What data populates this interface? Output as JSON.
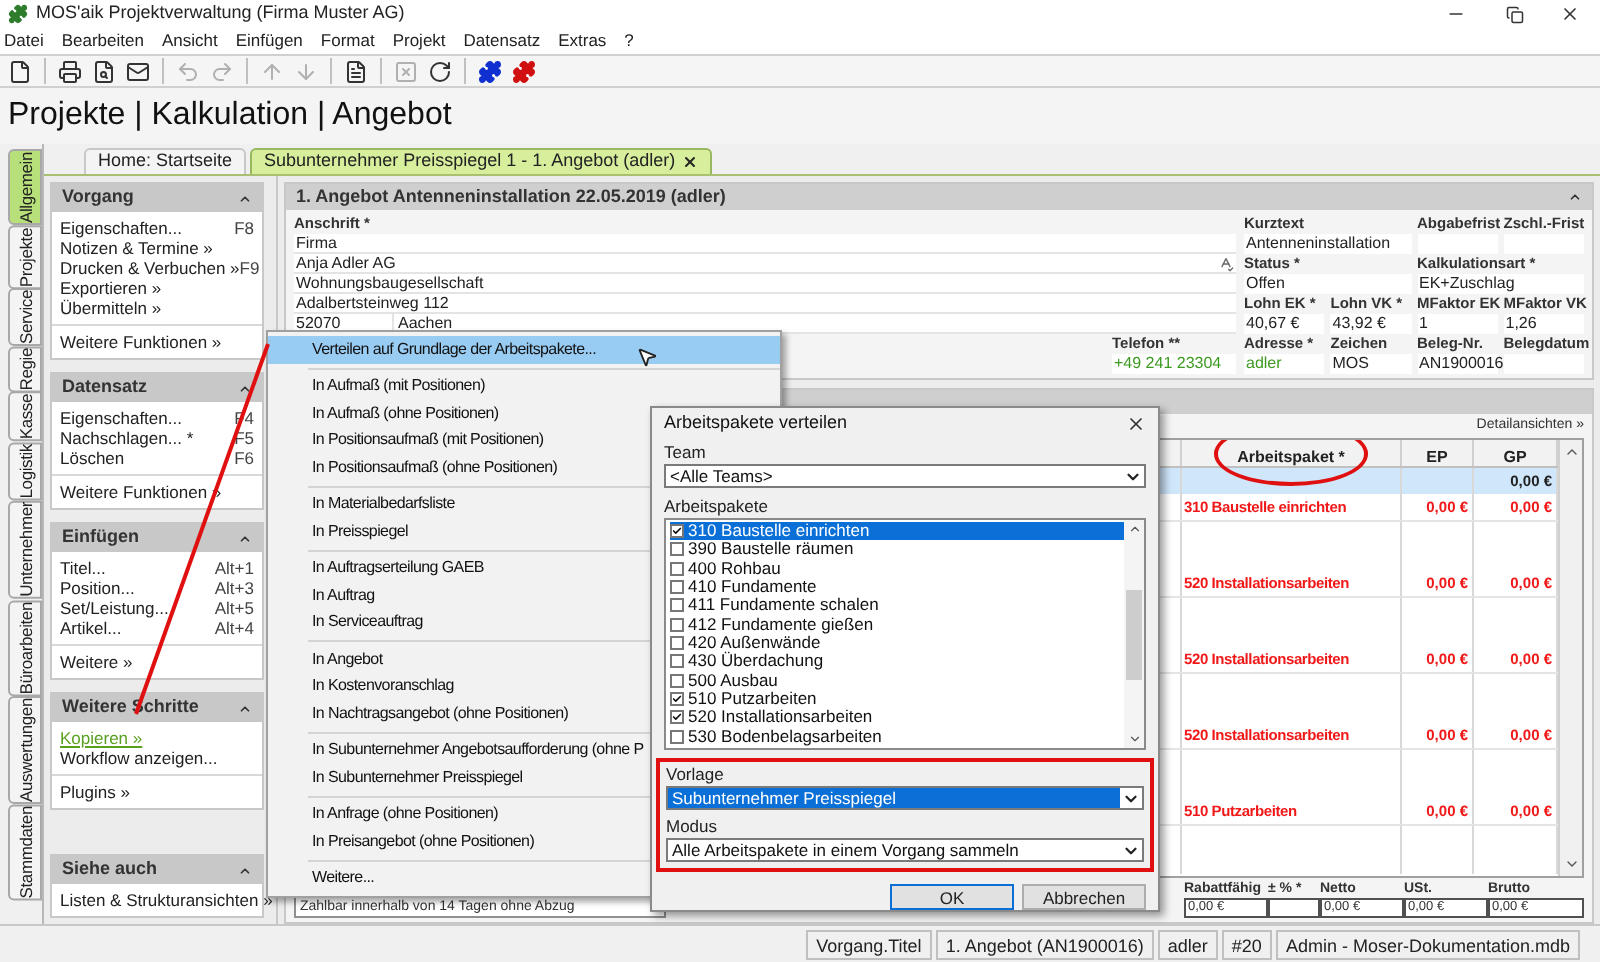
{
  "window": {
    "title": "MOS'aik Projektverwaltung (Firma Muster AG)"
  },
  "menu": [
    "Datei",
    "Bearbeiten",
    "Ansicht",
    "Einfügen",
    "Format",
    "Projekt",
    "Datensatz",
    "Extras",
    "?"
  ],
  "toolbar": [
    {
      "kind": "new",
      "disabled": false
    },
    {
      "kind": "separator"
    },
    {
      "kind": "print",
      "disabled": false
    },
    {
      "kind": "preview",
      "disabled": false
    },
    {
      "kind": "mail",
      "disabled": false
    },
    {
      "kind": "separator"
    },
    {
      "kind": "undo",
      "disabled": true
    },
    {
      "kind": "redo",
      "disabled": true
    },
    {
      "kind": "separator"
    },
    {
      "kind": "up",
      "disabled": true
    },
    {
      "kind": "down",
      "disabled": true
    },
    {
      "kind": "separator"
    },
    {
      "kind": "report",
      "disabled": false
    },
    {
      "kind": "separator"
    },
    {
      "kind": "delete",
      "disabled": true
    },
    {
      "kind": "refresh",
      "disabled": false
    },
    {
      "kind": "separator"
    },
    {
      "kind": "plugin_blue",
      "disabled": false
    },
    {
      "kind": "plugin_red",
      "disabled": false
    }
  ],
  "breadcrumb": "Projekte | Kalkulation | Angebot",
  "side_tabs": [
    {
      "label": "Allgemein",
      "selected": true
    },
    {
      "label": "Projekte",
      "selected": false
    },
    {
      "label": "Service",
      "selected": false
    },
    {
      "label": "Regie",
      "selected": false
    },
    {
      "label": "Kasse",
      "selected": false
    },
    {
      "label": "Logistik",
      "selected": false
    },
    {
      "label": "Unternehmer",
      "selected": false
    },
    {
      "label": "Büroarbeiten",
      "selected": false
    },
    {
      "label": "Auswertungen",
      "selected": false
    },
    {
      "label": "Stammdaten",
      "selected": false
    }
  ],
  "doc_tabs": [
    {
      "label": "Home: Startseite",
      "selected": false,
      "closable": false
    },
    {
      "label": "Subunternehmer Preisspiegel 1 - 1. Angebot (adler)",
      "selected": true,
      "closable": true
    }
  ],
  "sidebar": [
    {
      "title": "Vorgang",
      "groups": [
        [
          {
            "label": "Eigenschaften...",
            "shortcut": "F8"
          },
          {
            "label": "Notizen & Termine »"
          },
          {
            "label": "Drucken & Verbuchen »",
            "shortcut": "F9"
          },
          {
            "label": "Exportieren »"
          },
          {
            "label": "Übermitteln »"
          }
        ],
        [
          {
            "label": "Weitere Funktionen »"
          }
        ]
      ]
    },
    {
      "title": "Datensatz",
      "groups": [
        [
          {
            "label": "Eigenschaften...",
            "shortcut": "F4"
          },
          {
            "label": "Nachschlagen... *",
            "shortcut": "F5"
          },
          {
            "label": "Löschen",
            "shortcut": "F6"
          }
        ],
        [
          {
            "label": "Weitere Funktionen »"
          }
        ]
      ]
    },
    {
      "title": "Einfügen",
      "groups": [
        [
          {
            "label": "Titel...",
            "shortcut": "Alt+1"
          },
          {
            "label": "Position...",
            "shortcut": "Alt+3"
          },
          {
            "label": "Set/Leistung...",
            "shortcut": "Alt+5"
          },
          {
            "label": "Artikel...",
            "shortcut": "Alt+4"
          }
        ],
        [
          {
            "label": "Weitere »"
          }
        ]
      ]
    },
    {
      "title": "Weitere Schritte",
      "groups": [
        [
          {
            "label": "Kopieren »",
            "kind": "link"
          },
          {
            "label": "Workflow anzeigen..."
          }
        ],
        [
          {
            "label": "Plugins »"
          }
        ]
      ]
    },
    {
      "title": "Siehe auch",
      "groups": [
        [
          {
            "label": "Listen & Strukturansichten »"
          }
        ]
      ]
    }
  ],
  "document": {
    "title": "1. Angebot Antenneninstallation 22.05.2019 (adler)",
    "address": {
      "label": "Anschrift *",
      "lines": [
        "Firma",
        "Anja Adler AG",
        "Wohnungsbaugesellschaft",
        "Adalbertsteinweg 112"
      ],
      "zip": "52070",
      "city": "Aachen"
    },
    "phone": {
      "label": "Telefon **",
      "value": "+49 241 23304"
    },
    "field_rows": [
      [
        {
          "label": "Kurztext",
          "value": "Antenneninstallation"
        },
        {
          "label": "Abgabefrist"
        },
        {
          "label": "Zschl.-Frist"
        }
      ],
      [
        {
          "label": "Status *",
          "value": "Offen"
        },
        {
          "label": "Kalkulationsart *",
          "value": "EK+Zuschlag"
        }
      ],
      [
        {
          "label": "Lohn EK *",
          "value": "40,67 €"
        },
        {
          "label": "Lohn VK *",
          "value": "43,92 €"
        },
        {
          "label": "MFaktor EK",
          "value": "1"
        },
        {
          "label": "MFaktor VK",
          "value": "1,26"
        }
      ],
      [
        {
          "label": "Adresse *",
          "value": "adler",
          "link": true
        },
        {
          "label": "Zeichen",
          "value": "MOS"
        },
        {
          "label": "Beleg-Nr.",
          "value": "AN1900016"
        },
        {
          "label": "Belegdatum"
        }
      ]
    ]
  },
  "grid": {
    "details_link": "Detailansichten »",
    "columns": [
      "Arbeitspaket *",
      "EP",
      "GP"
    ],
    "rows": [
      {
        "gp": "0,00 €",
        "selected": true
      },
      {
        "package": "310 Baustelle einrichten",
        "ep": "0,00 €",
        "gp": "0,00 €",
        "selected": false
      },
      {
        "package": "520 Installationsarbeiten",
        "ep": "0,00 €",
        "gp": "0,00 €",
        "selected": false
      },
      {
        "package": "520 Installationsarbeiten",
        "ep": "0,00 €",
        "gp": "0,00 €",
        "selected": false
      },
      {
        "package": "520 Installationsarbeiten",
        "ep": "0,00 €",
        "gp": "0,00 €",
        "selected": false
      },
      {
        "package": "510 Putzarbeiten",
        "ep": "0,00 €",
        "gp": "0,00 €",
        "selected": false
      }
    ]
  },
  "payment_terms": "Zahlbar innerhalb von 14 Tagen ohne Abzug",
  "totals": [
    {
      "label": "Rabattfähig",
      "value": "0,00 €"
    },
    {
      "label": "± % *"
    },
    {
      "label": "Netto",
      "value": "0,00 €"
    },
    {
      "label": "USt.",
      "value": "0,00 €"
    },
    {
      "label": "Brutto",
      "value": "0,00 €"
    }
  ],
  "context_menu": {
    "groups": [
      [
        {
          "label": "Verteilen auf Grundlage der Arbeitspakete...",
          "selected": true
        }
      ],
      [
        {
          "label": "In Aufmaß (mit Positionen)",
          "selected": false
        },
        {
          "label": "In Aufmaß (ohne Positionen)",
          "selected": false
        },
        {
          "label": "In Positionsaufmaß (mit Positionen)",
          "selected": false
        },
        {
          "label": "In Positionsaufmaß (ohne Positionen)",
          "selected": false
        }
      ],
      [
        {
          "label": "In Materialbedarfsliste",
          "selected": false
        },
        {
          "label": "In Preisspiegel",
          "selected": false
        }
      ],
      [
        {
          "label": "In Auftragserteilung GAEB",
          "selected": false
        },
        {
          "label": "In Auftrag",
          "selected": false
        },
        {
          "label": "In Serviceauftrag",
          "selected": false
        }
      ],
      [
        {
          "label": "In Angebot",
          "selected": false
        },
        {
          "label": "In Kostenvoranschlag",
          "selected": false
        },
        {
          "label": "In Nachtragsangebot (ohne Positionen)",
          "selected": false
        }
      ],
      [
        {
          "label": "In Subunternehmer Angebotsaufforderung (ohne P",
          "selected": false
        },
        {
          "label": "In Subunternehmer Preisspiegel",
          "selected": false
        }
      ],
      [
        {
          "label": "In Anfrage (ohne Positionen)",
          "selected": false
        },
        {
          "label": "In Preisangebot (ohne Positionen)",
          "selected": false
        }
      ],
      [
        {
          "label": "Weitere...",
          "selected": false
        }
      ]
    ]
  },
  "dialog": {
    "title": "Arbeitspakete verteilen",
    "team": {
      "label": "Team",
      "value": "<Alle Teams>"
    },
    "packages": {
      "label": "Arbeitspakete",
      "items": [
        {
          "label": "310 Baustelle einrichten",
          "checked": true,
          "selected": true
        },
        {
          "label": "390 Baustelle räumen",
          "checked": false,
          "selected": false
        },
        {
          "label": "400 Rohbau",
          "checked": false,
          "selected": false
        },
        {
          "label": "410 Fundamente",
          "checked": false,
          "selected": false
        },
        {
          "label": "411 Fundamente schalen",
          "checked": false,
          "selected": false
        },
        {
          "label": "412 Fundamente gießen",
          "checked": false,
          "selected": false
        },
        {
          "label": "420 Außenwände",
          "checked": false,
          "selected": false
        },
        {
          "label": "430 Überdachung",
          "checked": false,
          "selected": false
        },
        {
          "label": "500 Ausbau",
          "checked": false,
          "selected": false
        },
        {
          "label": "510 Putzarbeiten",
          "checked": true,
          "selected": false
        },
        {
          "label": "520 Installationsarbeiten",
          "checked": true,
          "selected": false
        },
        {
          "label": "530 Bodenbelagsarbeiten",
          "checked": false,
          "selected": false
        }
      ]
    },
    "template": {
      "label": "Vorlage",
      "value": "Subunternehmer Preisspiegel",
      "selected": true
    },
    "mode": {
      "label": "Modus",
      "value": "Alle Arbeitspakete in einem Vorgang sammeln",
      "selected": false
    },
    "buttons": [
      "OK",
      "Abbrechen"
    ]
  },
  "status_bar": [
    "Vorgang.Titel",
    "1. Angebot (AN1900016)",
    "adler",
    "#20",
    "Admin - Moser-Dokumentation.mdb"
  ]
}
